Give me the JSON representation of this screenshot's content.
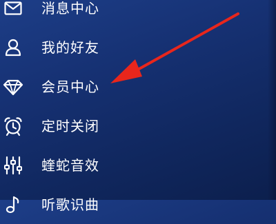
{
  "menu": {
    "items": [
      {
        "label": "消息中心",
        "icon": "envelope-icon"
      },
      {
        "label": "我的好友",
        "icon": "friends-icon"
      },
      {
        "label": "会员中心",
        "icon": "diamond-icon"
      },
      {
        "label": "定时关闭",
        "icon": "alarm-clock-icon"
      },
      {
        "label": "蝰蛇音效",
        "icon": "equalizer-icon"
      },
      {
        "label": "听歌识曲",
        "icon": "music-note-icon"
      }
    ]
  },
  "annotation": {
    "type": "arrow",
    "color": "#e8261c"
  },
  "colors": {
    "background": "#163173",
    "text": "#ffffff",
    "arrow": "#e8261c"
  }
}
